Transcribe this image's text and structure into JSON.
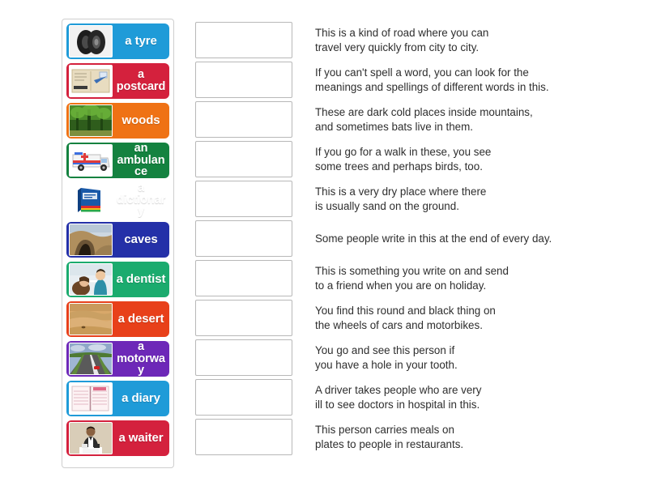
{
  "activity": {
    "type": "match-up",
    "instruction_visible": false
  },
  "tiles": [
    {
      "label": "a tyre",
      "color": "#1f9bd8",
      "icon": "tyre-photo",
      "lines": 1
    },
    {
      "label": "a postcard",
      "color": "#d4213d",
      "icon": "postcard-photo",
      "lines": 2
    },
    {
      "label": "woods",
      "color": "#ef7215",
      "icon": "woods-photo",
      "lines": 1
    },
    {
      "label": "an ambulance",
      "color": "#148240",
      "icon": "ambulance-photo",
      "lines": 2
    },
    {
      "label": "a dictionary",
      "color": "#c martial",
      "icon": "dictionary-photo",
      "lines": 2
    },
    {
      "label": "caves",
      "color": "#2430a8",
      "icon": "caves-photo",
      "lines": 1
    },
    {
      "label": "a dentist",
      "color": "#1bab6e",
      "icon": "dentist-photo",
      "lines": 1
    },
    {
      "label": "a desert",
      "color": "#e8401a",
      "icon": "desert-photo",
      "lines": 1
    },
    {
      "label": "a motorway",
      "color": "#6d28b8",
      "icon": "motorway-photo",
      "lines": 2
    },
    {
      "label": "a diary",
      "color": "#1f9bd8",
      "icon": "diary-photo",
      "lines": 1
    },
    {
      "label": "a waiter",
      "color": "#d4213d",
      "icon": "waiter-photo",
      "lines": 1
    }
  ],
  "questions": [
    {
      "text": "This is a kind of road where you can\ntravel very quickly from city to city.",
      "answer": ""
    },
    {
      "text": "If you can't spell a word, you can look for the\nmeanings and spellings of different words in this.",
      "answer": ""
    },
    {
      "text": "These are dark cold places inside mountains,\nand sometimes bats live in them.",
      "answer": ""
    },
    {
      "text": "If you go for a walk in these, you see\nsome trees and perhaps birds, too.",
      "answer": ""
    },
    {
      "text": "This is a very dry place where there\nis usually sand on the ground.",
      "answer": ""
    },
    {
      "text": "Some people write in this at the end of every day.",
      "answer": ""
    },
    {
      "text": "This is something you write on and send\nto a friend when you are on holiday.",
      "answer": ""
    },
    {
      "text": "You find this round and black thing on\nthe wheels of cars and motorbikes.",
      "answer": ""
    },
    {
      "text": "You go and see this person if\nyou have a hole in your tooth.",
      "answer": ""
    },
    {
      "text": "A driver takes people who are very\nill to see doctors in hospital in this.",
      "answer": ""
    },
    {
      "text": "This person carries meals on\nplates to people in restaurants.",
      "answer": ""
    }
  ]
}
